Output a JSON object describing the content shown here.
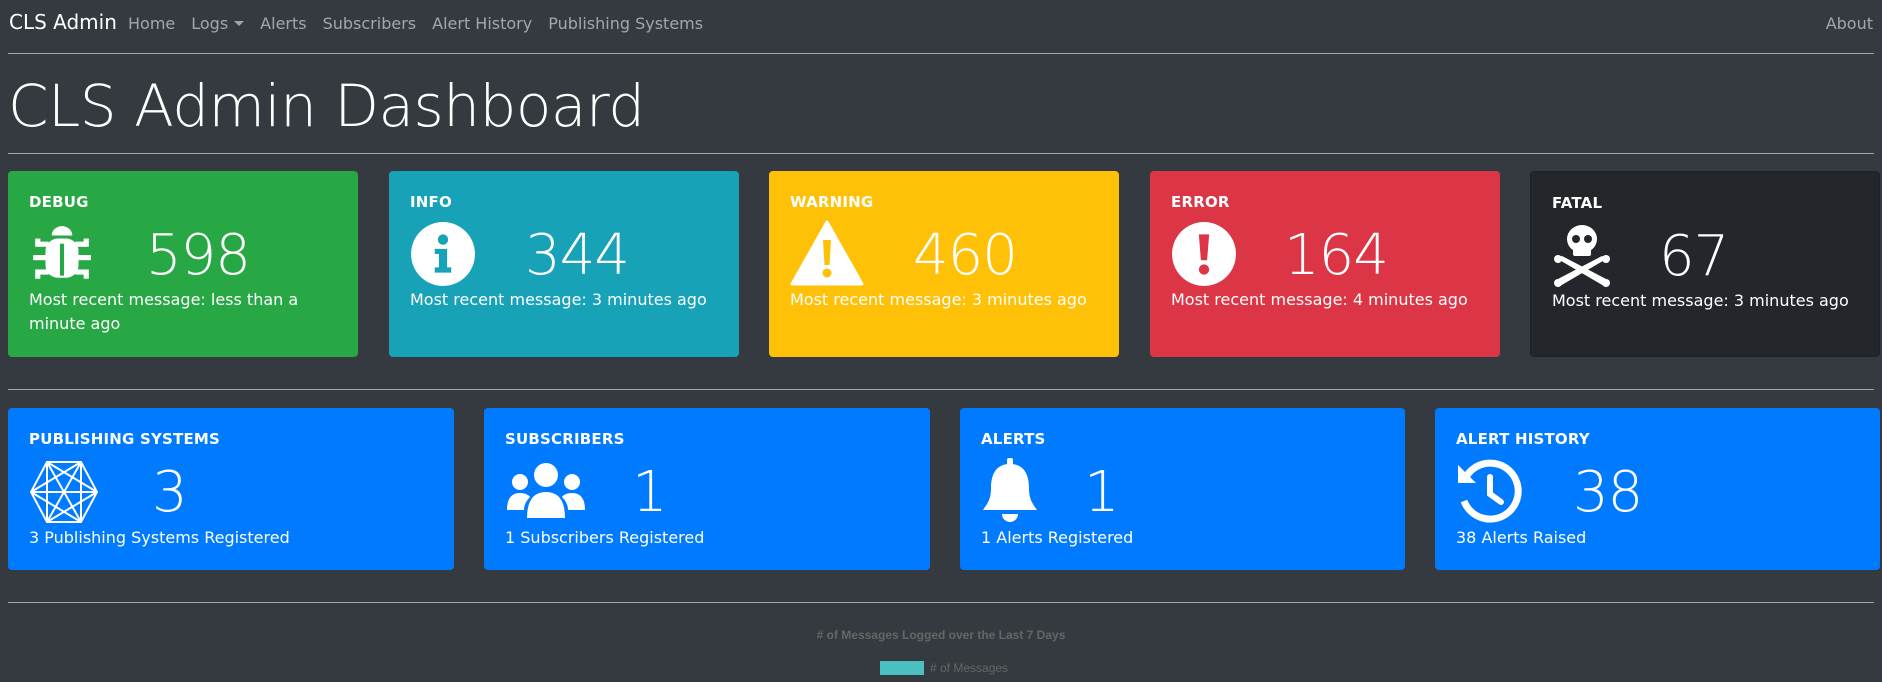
{
  "navbar": {
    "brand": "CLS Admin",
    "links": [
      "Home",
      "Logs",
      "Alerts",
      "Subscribers",
      "Alert History",
      "Publishing Systems"
    ],
    "about": "About"
  },
  "page_title": "CLS Admin Dashboard",
  "log_cards": [
    {
      "title": "DEBUG",
      "count": "598",
      "message": "Most recent message: less than a minute ago",
      "color": "#28a745",
      "icon": "bug-icon"
    },
    {
      "title": "INFO",
      "count": "344",
      "message": "Most recent message: 3 minutes ago",
      "color": "#17a2b8",
      "icon": "info-circle-icon"
    },
    {
      "title": "WARNING",
      "count": "460",
      "message": "Most recent message: 3 minutes ago",
      "color": "#ffc107",
      "icon": "warning-triangle-icon"
    },
    {
      "title": "ERROR",
      "count": "164",
      "message": "Most recent message: 4 minutes ago",
      "color": "#dc3545",
      "icon": "exclamation-circle-icon"
    },
    {
      "title": "FATAL",
      "count": "67",
      "message": "Most recent message: 3 minutes ago",
      "color": "#23272b",
      "icon": "skull-crossbones-icon"
    }
  ],
  "system_cards": [
    {
      "title": "PUBLISHING SYSTEMS",
      "count": "3",
      "message": "3 Publishing Systems Registered",
      "icon": "network-icon"
    },
    {
      "title": "SUBSCRIBERS",
      "count": "1",
      "message": "1 Subscribers Registered",
      "icon": "users-icon"
    },
    {
      "title": "ALERTS",
      "count": "1",
      "message": "1 Alerts Registered",
      "icon": "bell-icon"
    },
    {
      "title": "ALERT HISTORY",
      "count": "38",
      "message": "38 Alerts Raised",
      "icon": "history-icon"
    }
  ],
  "system_card_color": "#007bff",
  "chart": {
    "title": "# of Messages Logged over the Last 7 Days",
    "legend_label": "# of Messages",
    "legend_color": "#4bc0c0"
  }
}
